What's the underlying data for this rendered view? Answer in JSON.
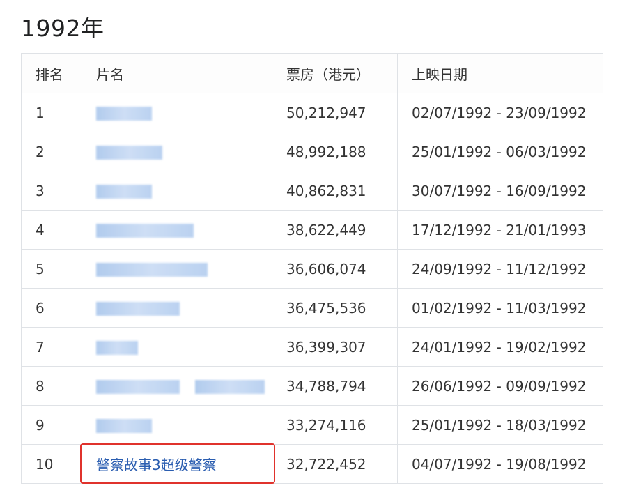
{
  "page": {
    "title": "1992年"
  },
  "table": {
    "headers": {
      "rank": "排名",
      "title": "片名",
      "box_office": "票房（港元）",
      "release": "上映日期"
    },
    "rows": [
      {
        "rank": "1",
        "title": "",
        "title_blurred": true,
        "blur_segments": [
          80
        ],
        "box_office": "50,212,947",
        "release": "02/07/1992 - 23/09/1992"
      },
      {
        "rank": "2",
        "title": "",
        "title_blurred": true,
        "blur_segments": [
          95
        ],
        "box_office": "48,992,188",
        "release": "25/01/1992 - 06/03/1992"
      },
      {
        "rank": "3",
        "title": "",
        "title_blurred": true,
        "blur_segments": [
          80
        ],
        "box_office": "40,862,831",
        "release": "30/07/1992 - 16/09/1992"
      },
      {
        "rank": "4",
        "title": "",
        "title_blurred": true,
        "blur_segments": [
          140
        ],
        "box_office": "38,622,449",
        "release": "17/12/1992 - 21/01/1993"
      },
      {
        "rank": "5",
        "title": "",
        "title_blurred": true,
        "blur_segments": [
          160
        ],
        "box_office": "36,606,074",
        "release": "24/09/1992 - 11/12/1992"
      },
      {
        "rank": "6",
        "title": "",
        "title_blurred": true,
        "blur_segments": [
          120
        ],
        "box_office": "36,475,536",
        "release": "01/02/1992 - 11/03/1992"
      },
      {
        "rank": "7",
        "title": "",
        "title_blurred": true,
        "blur_segments": [
          60
        ],
        "box_office": "36,399,307",
        "release": "24/01/1992 - 19/02/1992"
      },
      {
        "rank": "8",
        "title": "",
        "title_blurred": true,
        "blur_segments": [
          120,
          100
        ],
        "box_office": "34,788,794",
        "release": "26/06/1992 - 09/09/1992"
      },
      {
        "rank": "9",
        "title": "",
        "title_blurred": true,
        "blur_segments": [
          80
        ],
        "box_office": "33,274,116",
        "release": "25/01/1992 - 18/03/1992"
      },
      {
        "rank": "10",
        "title": "警察故事3超级警察",
        "title_blurred": false,
        "blur_segments": [],
        "box_office": "32,722,452",
        "release": "04/07/1992 - 19/08/1992",
        "highlighted": true
      }
    ]
  },
  "colors": {
    "link": "#2a5db0",
    "highlight_border": "#e0322c",
    "grid": "#dfe2e6",
    "blur": "#b3cdef"
  }
}
